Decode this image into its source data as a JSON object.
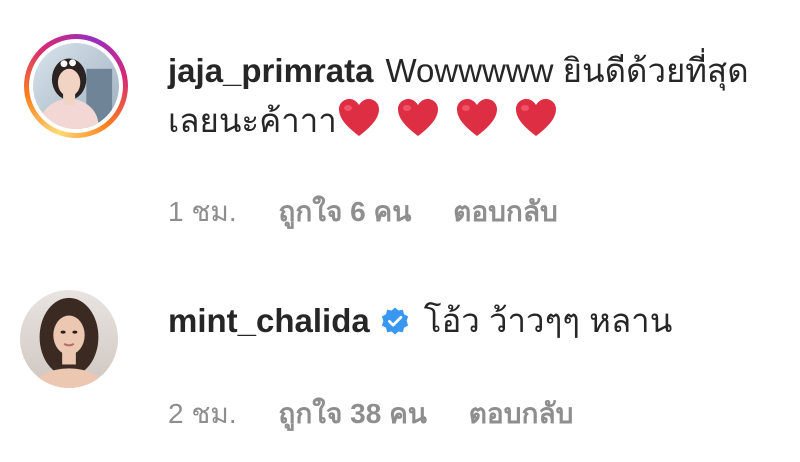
{
  "comments": [
    {
      "username": "jaja_primrata",
      "text": "Wowwwww ยินดีด้วยที่สุดเลยนะค้าาา",
      "hearts": 4,
      "time": "1 ชม.",
      "likes": "ถูกใจ 6 คน",
      "reply": "ตอบกลับ",
      "verified": false,
      "has_story_ring": true
    },
    {
      "username": "mint_chalida",
      "text": "โอ้ว ว้าวๆๆ หลาน",
      "hearts": 0,
      "time": "2 ชม.",
      "likes": "ถูกใจ 38 คน",
      "reply": "ตอบกลับ",
      "verified": true,
      "has_story_ring": false
    }
  ],
  "colors": {
    "text": "#262626",
    "meta": "#8e8e8e",
    "verified": "#3897f0",
    "heart": "#dd2e44"
  }
}
